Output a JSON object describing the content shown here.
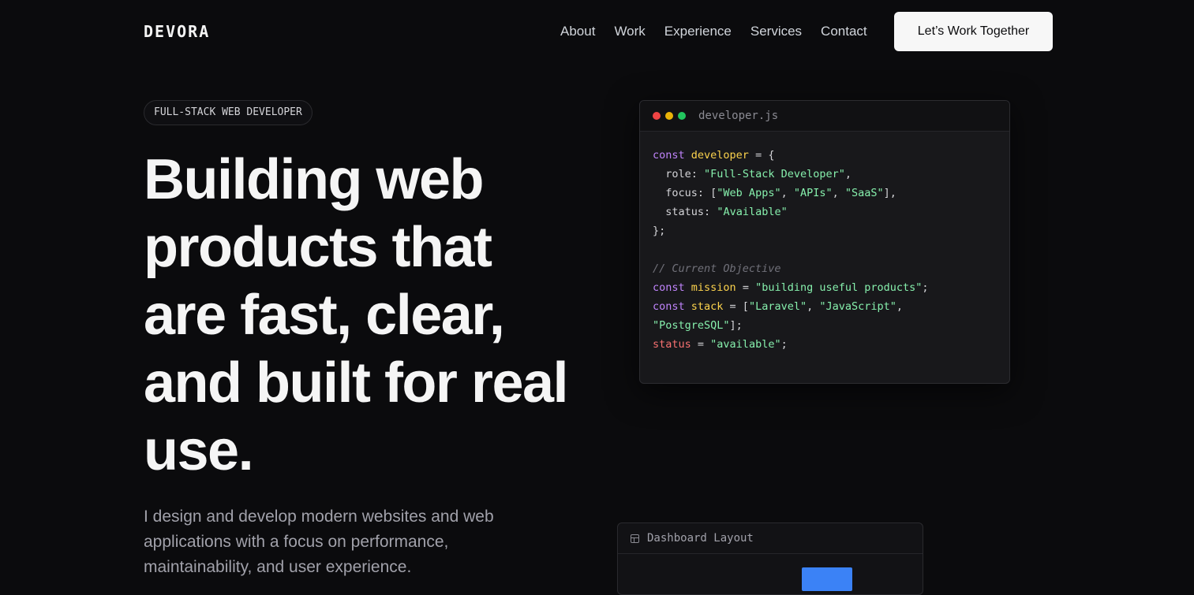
{
  "header": {
    "logo": "DEVORA",
    "nav": [
      "About",
      "Work",
      "Experience",
      "Services",
      "Contact"
    ],
    "cta": "Let’s Work Together"
  },
  "hero": {
    "badge": "FULL-STACK WEB DEVELOPER",
    "headline": "Building web products that are fast, clear, and built for real use.",
    "intro": "I design and develop modern websites and web applications with a focus on performance, maintainability, and user experience."
  },
  "code_card": {
    "filename": "developer.js",
    "lines": {
      "l1_kw": "const",
      "l1_var": "developer",
      "l1_rest": " = {",
      "role_key": "role",
      "role_val": "\"Full-Stack Developer\"",
      "focus_key": "focus",
      "focus_v1": "\"Web Apps\"",
      "focus_v2": "\"APIs\"",
      "focus_v3": "\"SaaS\"",
      "status_key": "status",
      "status_val": "\"Available\"",
      "close": "};",
      "comment": "// Current Objective",
      "mission_kw": "const",
      "mission_var": "mission",
      "mission_val": "\"building useful products\"",
      "stack_kw": "const",
      "stack_var": "stack",
      "stack_v1": "\"Laravel\"",
      "stack_v2": "\"JavaScript\"",
      "stack_v3": "\"PostgreSQL\"",
      "st_var": "status",
      "st_val": "\"available\""
    }
  },
  "dashboard_card": {
    "title": "Dashboard Layout"
  },
  "colors": {
    "background": "#0b0b0d",
    "accent_blue": "#3b82f6",
    "keyword": "#c084fc",
    "variable": "#fcd34d",
    "string": "#86efac"
  }
}
